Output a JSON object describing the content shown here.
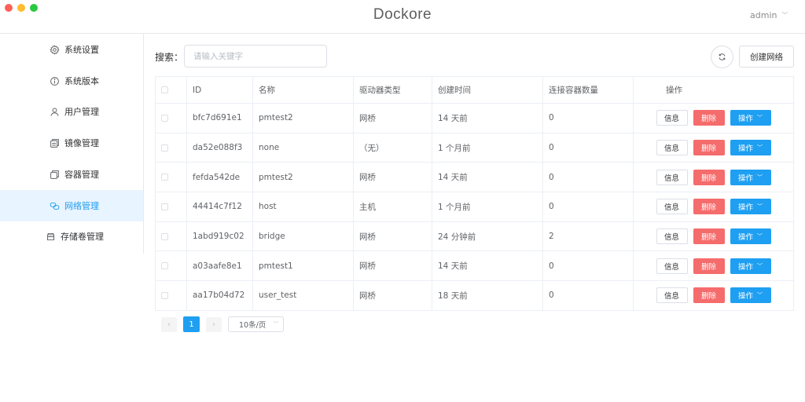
{
  "app": {
    "title": "Dockore",
    "user": "admin"
  },
  "sidebar": {
    "items": [
      {
        "label": "系统设置",
        "icon": "gear-icon"
      },
      {
        "label": "系统版本",
        "icon": "info-icon"
      },
      {
        "label": "用户管理",
        "icon": "user-icon"
      },
      {
        "label": "镜像管理",
        "icon": "image-stack-icon"
      },
      {
        "label": "容器管理",
        "icon": "container-icon"
      },
      {
        "label": "网络管理",
        "icon": "network-icon",
        "active": true
      },
      {
        "label": "存储卷管理",
        "icon": "volume-icon"
      }
    ]
  },
  "search": {
    "label": "搜索：",
    "placeholder": "请输入关键字",
    "value": ""
  },
  "toolbar": {
    "create_label": "创建网络"
  },
  "table": {
    "headers": {
      "id": "ID",
      "name": "名称",
      "driver": "驱动器类型",
      "created": "创建时间",
      "containers": "连接容器数量",
      "ops": "操作"
    },
    "row_actions": {
      "info": "信息",
      "delete": "删除",
      "ops": "操作"
    },
    "rows": [
      {
        "id": "bfc7d691e1",
        "name": "pmtest2",
        "driver": "网桥",
        "created": "14 天前",
        "containers": "0"
      },
      {
        "id": "da52e088f3",
        "name": "none",
        "driver": "（无）",
        "created": "1 个月前",
        "containers": "0"
      },
      {
        "id": "fefda542de",
        "name": "pmtest2",
        "driver": "网桥",
        "created": "14 天前",
        "containers": "0"
      },
      {
        "id": "44414c7f12",
        "name": "host",
        "driver": "主机",
        "created": "1 个月前",
        "containers": "0"
      },
      {
        "id": "1abd919c02",
        "name": "bridge",
        "driver": "网桥",
        "created": "24 分钟前",
        "containers": "2"
      },
      {
        "id": "a03aafe8e1",
        "name": "pmtest1",
        "driver": "网桥",
        "created": "14 天前",
        "containers": "0"
      },
      {
        "id": "aa17b04d72",
        "name": "user_test",
        "driver": "网桥",
        "created": "18 天前",
        "containers": "0"
      }
    ]
  },
  "pagination": {
    "current": "1",
    "page_size": "10条/页"
  },
  "colors": {
    "accent": "#1e9ff2",
    "danger": "#f56c6c",
    "active_bg": "#e8f4ff"
  }
}
